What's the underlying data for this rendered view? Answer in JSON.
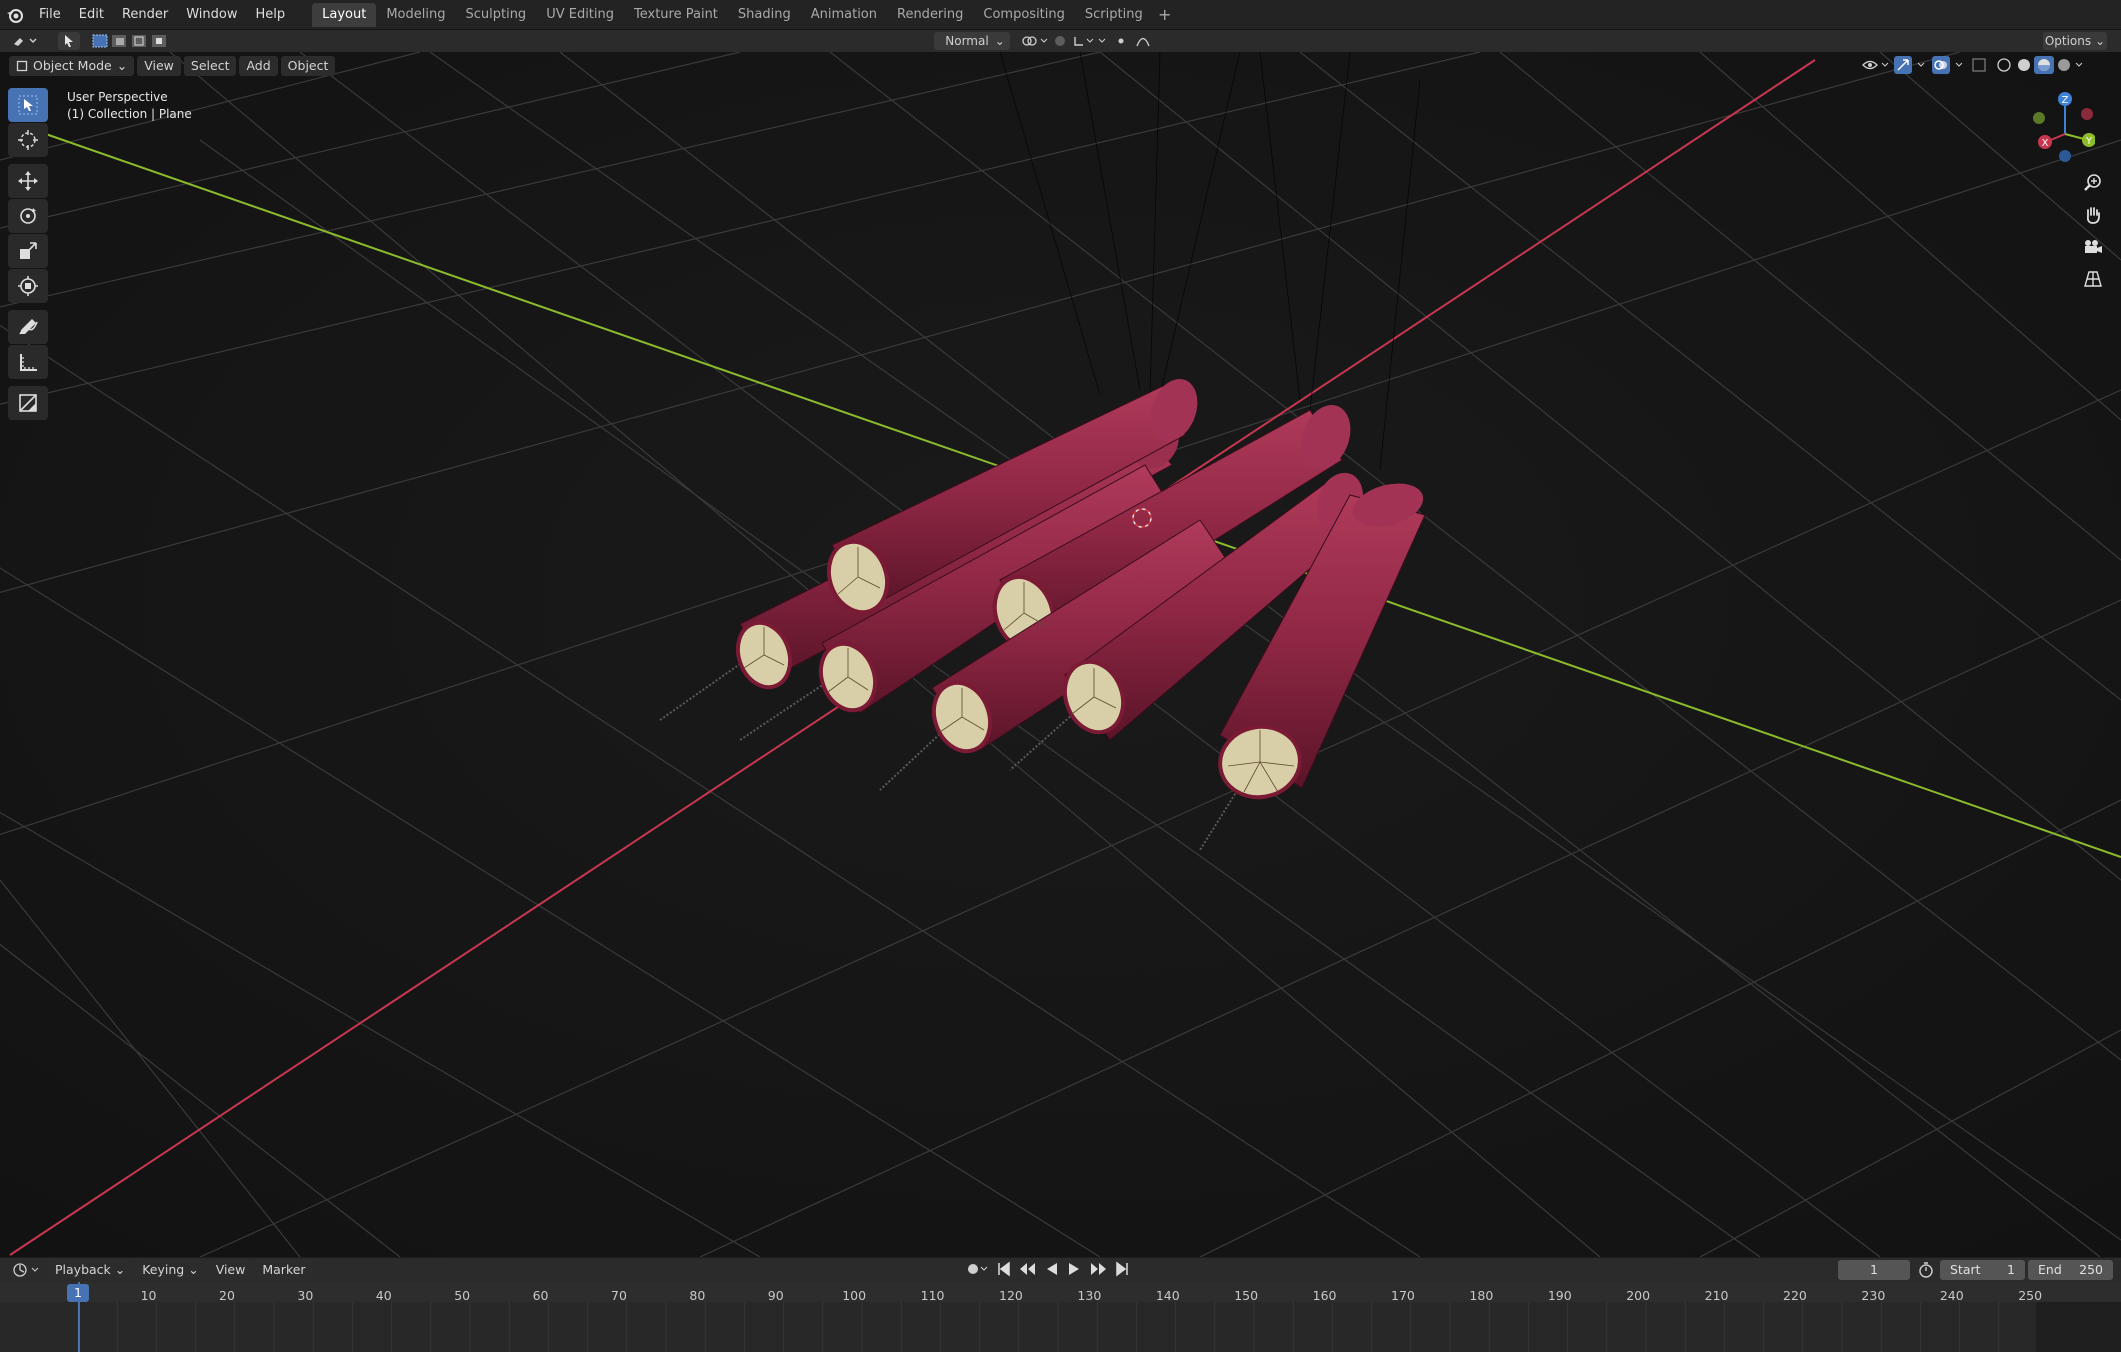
{
  "menu": {
    "items": [
      "File",
      "Edit",
      "Render",
      "Window",
      "Help"
    ]
  },
  "workspaces": {
    "tabs": [
      "Layout",
      "Modeling",
      "Sculpting",
      "UV Editing",
      "Texture Paint",
      "Shading",
      "Animation",
      "Rendering",
      "Compositing",
      "Scripting"
    ],
    "active": "Layout",
    "add_symbol": "+"
  },
  "tool_header": {
    "orientation": "Normal",
    "options": "Options"
  },
  "viewport_header": {
    "mode": "Object Mode",
    "menus": [
      "View",
      "Select",
      "Add",
      "Object"
    ]
  },
  "viewport": {
    "perspective": "User Perspective",
    "collection": "(1) Collection | Plane"
  },
  "gizmo": {
    "x": "X",
    "y": "Y",
    "z": "Z"
  },
  "colors": {
    "accent": "#4772b3",
    "x_axis": "#c8374f",
    "y_axis": "#8cbc2b",
    "z_axis": "#3d82d6",
    "dynamite": "#8c2642",
    "dynamite_end": "#d8cfa8"
  },
  "timeline": {
    "menus": [
      "Playback",
      "Keying",
      "View",
      "Marker"
    ],
    "current_frame": "1",
    "start_label": "Start",
    "start": "1",
    "end_label": "End",
    "end": "250",
    "ticks": [
      "10",
      "20",
      "30",
      "40",
      "50",
      "60",
      "70",
      "80",
      "90",
      "100",
      "110",
      "120",
      "130",
      "140",
      "150",
      "160",
      "170",
      "180",
      "190",
      "200",
      "210",
      "220",
      "230",
      "240",
      "250"
    ],
    "playhead": "1"
  }
}
